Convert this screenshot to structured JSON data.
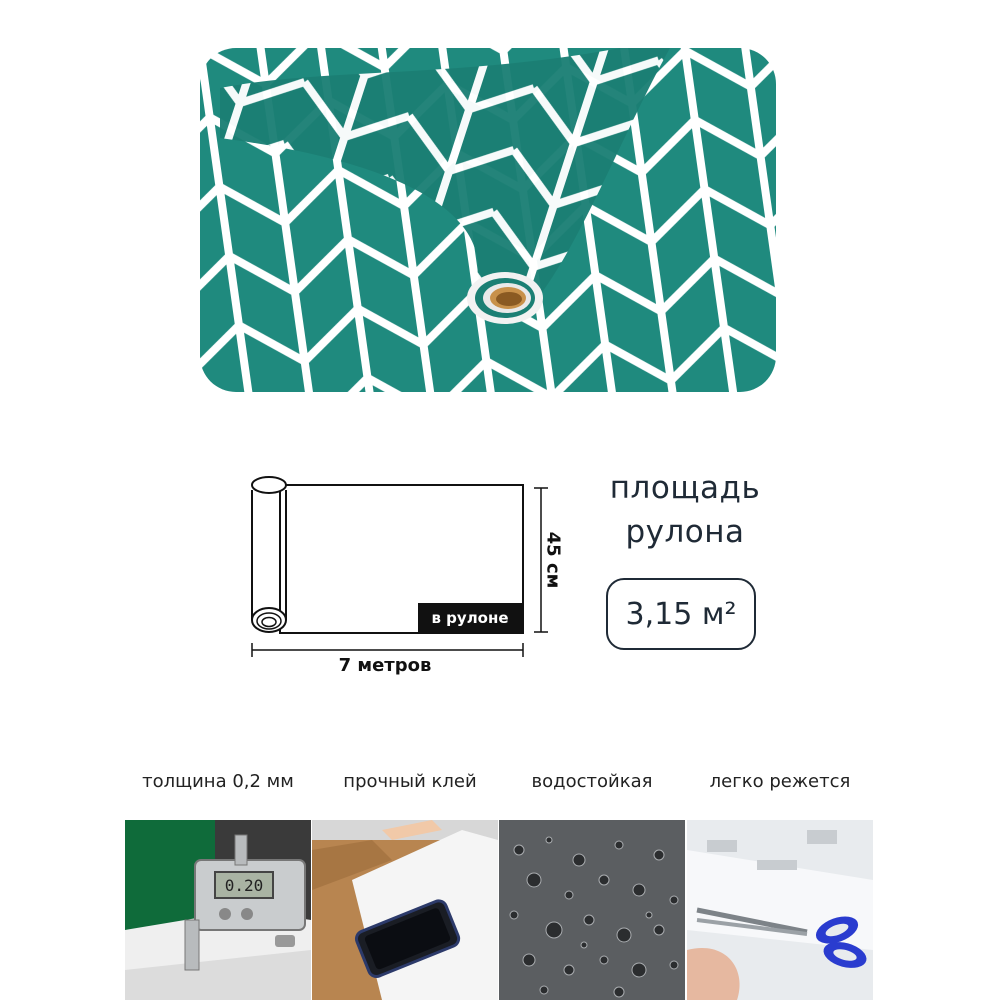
{
  "diagram": {
    "in_roll_label": "в рулоне",
    "height_label": "45 см",
    "width_label": "7 метров"
  },
  "area": {
    "title_line1": "площадь",
    "title_line2": "рулона",
    "value": "3,15 м²"
  },
  "features": [
    {
      "label": "толщина 0,2 мм",
      "image": "caliper-measuring-film"
    },
    {
      "label": "прочный клей",
      "image": "phone-on-adhesive-film"
    },
    {
      "label": "водостойкая",
      "image": "water-droplets"
    },
    {
      "label": "легко режется",
      "image": "scissors-cutting-film"
    }
  ],
  "caliper_readout": "0.20",
  "colors": {
    "film_green": "#1f8a7e",
    "pattern_line": "#ffffff",
    "caliper_green": "#0f6b3a",
    "scissors_handle": "#2a3ccf"
  }
}
